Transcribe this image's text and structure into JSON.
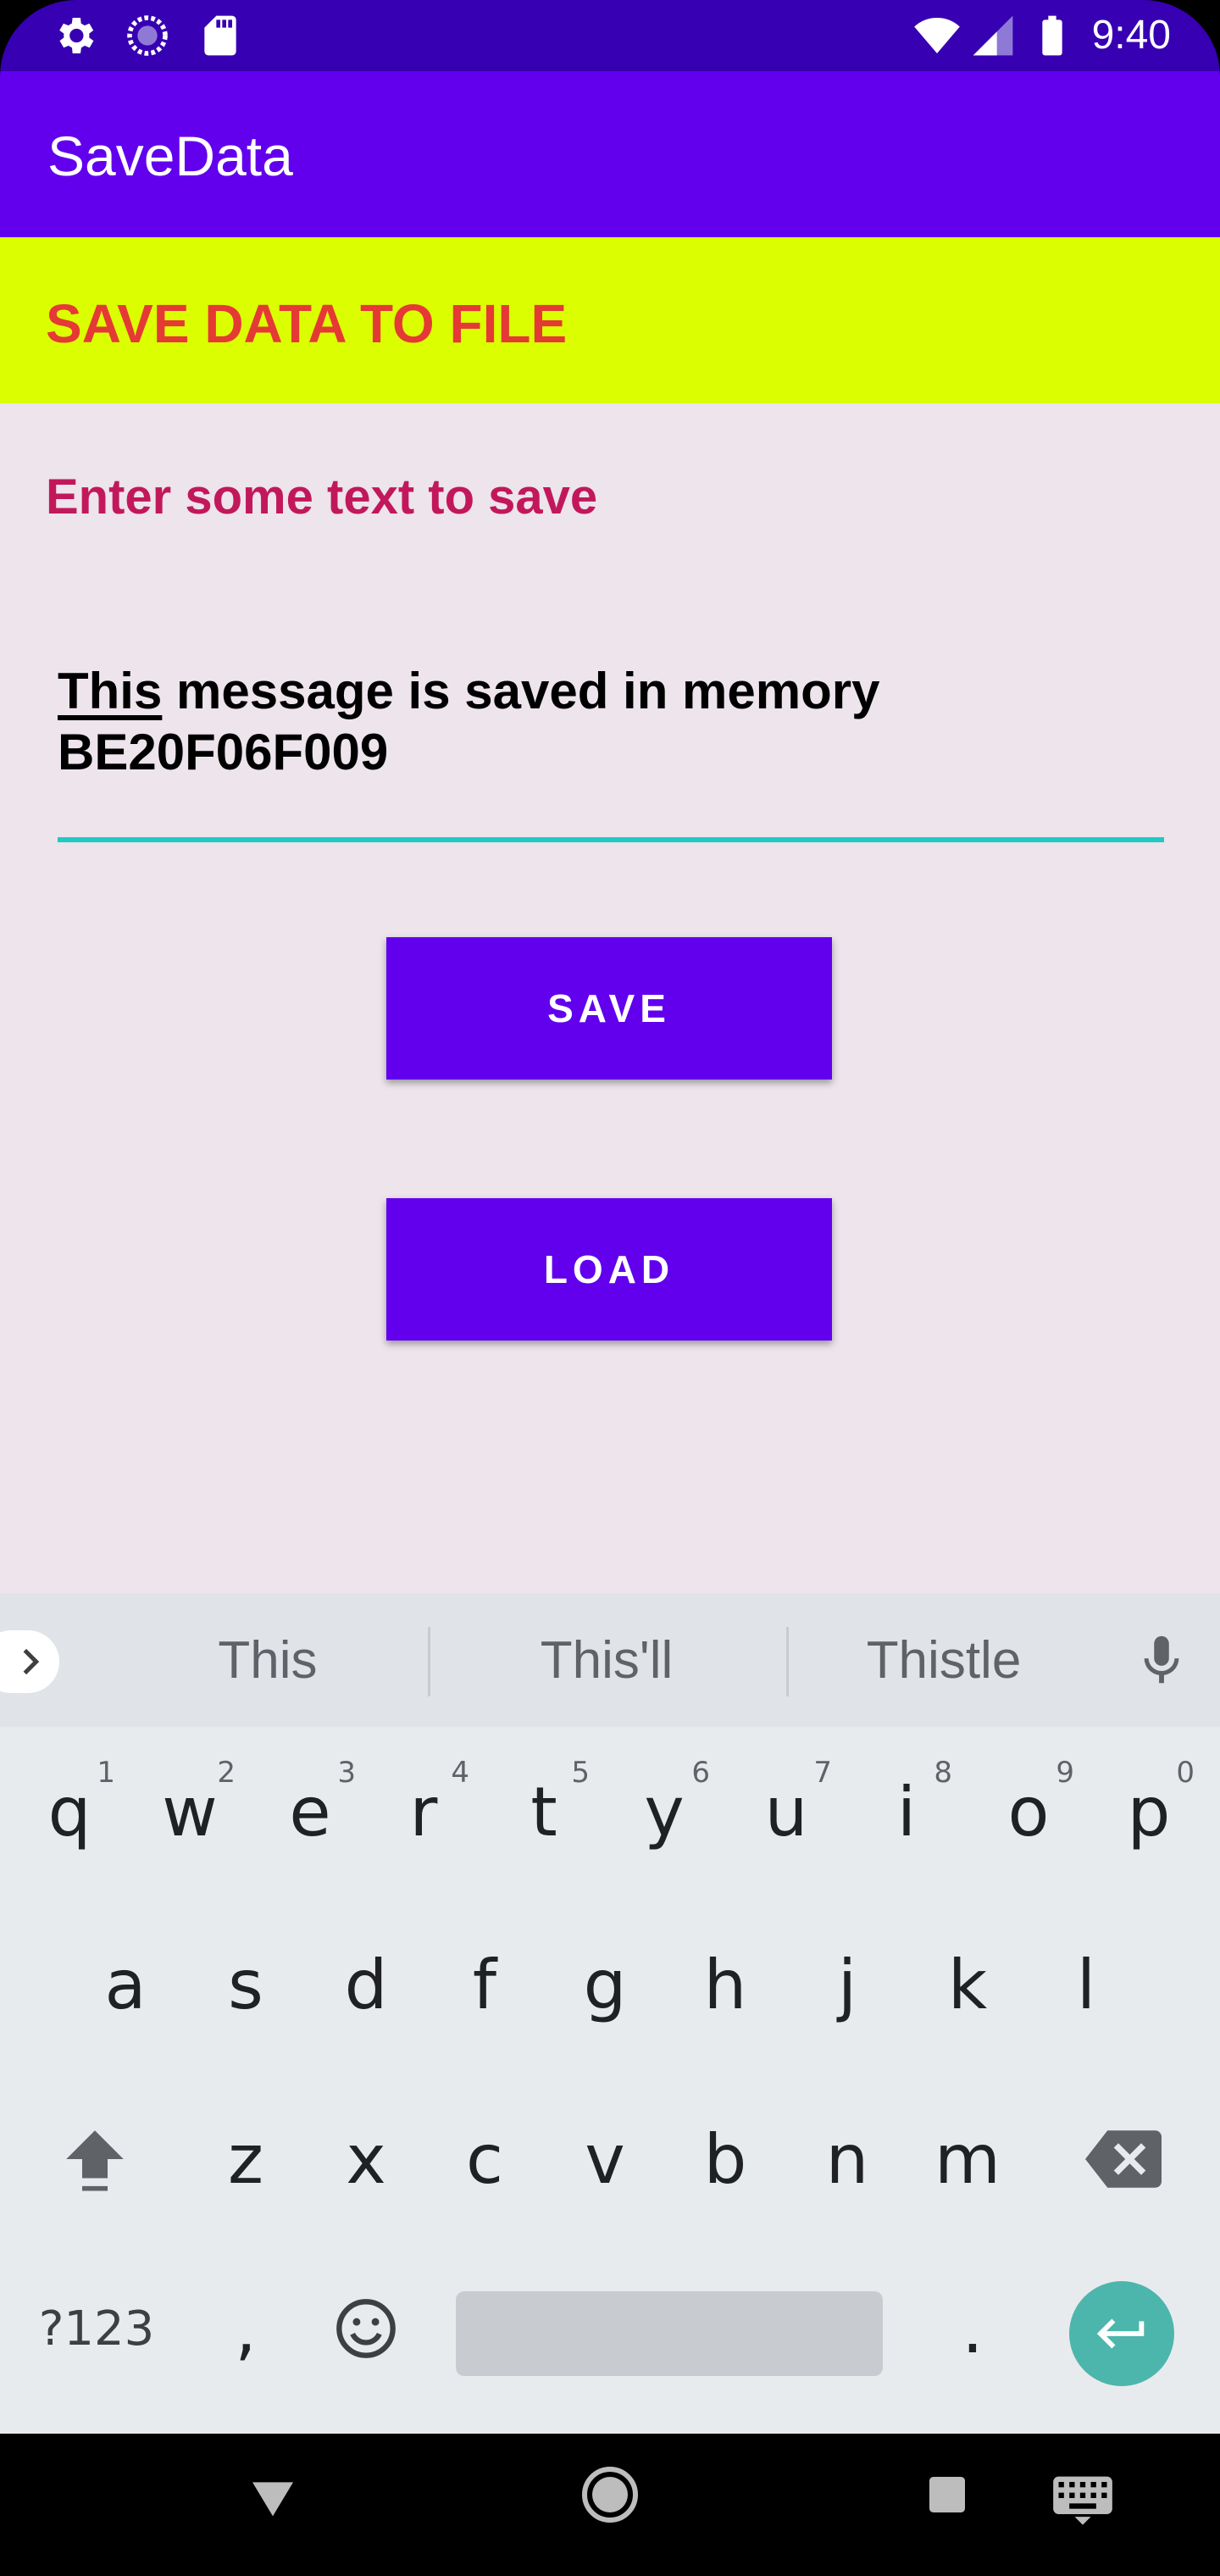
{
  "status_bar": {
    "time": "9:40",
    "left_icons": [
      "gear-icon",
      "loading-circle-icon",
      "sd-card-icon"
    ],
    "right_icons": [
      "wifi-icon",
      "signal-icon",
      "battery-icon"
    ]
  },
  "app_bar": {
    "title": "SaveData"
  },
  "banner": {
    "text": "SAVE DATA TO FILE"
  },
  "form": {
    "prompt": "Enter some text to save",
    "input_first_word": "This",
    "input_rest": " message is saved in memory\nBE20F06F009"
  },
  "buttons": {
    "save": "SAVE",
    "load": "LOAD"
  },
  "keyboard": {
    "suggestions": [
      "This",
      "This'll",
      "Thistle"
    ],
    "row1": [
      {
        "k": "q",
        "h": "1"
      },
      {
        "k": "w",
        "h": "2"
      },
      {
        "k": "e",
        "h": "3"
      },
      {
        "k": "r",
        "h": "4"
      },
      {
        "k": "t",
        "h": "5"
      },
      {
        "k": "y",
        "h": "6"
      },
      {
        "k": "u",
        "h": "7"
      },
      {
        "k": "i",
        "h": "8"
      },
      {
        "k": "o",
        "h": "9"
      },
      {
        "k": "p",
        "h": "0"
      }
    ],
    "row2": [
      "a",
      "s",
      "d",
      "f",
      "g",
      "h",
      "j",
      "k",
      "l"
    ],
    "row3": [
      "z",
      "x",
      "c",
      "v",
      "b",
      "n",
      "m"
    ],
    "symbols_label": "?123",
    "comma": ",",
    "period": "."
  },
  "colors": {
    "status_bar": "#3700b3",
    "primary": "#6200ee",
    "banner_bg": "#dbff00",
    "banner_text": "#e53935",
    "prompt_text": "#c2185b",
    "input_underline": "#20c9c3",
    "content_bg": "#ede4ec",
    "enter_key": "#4db6ac"
  }
}
